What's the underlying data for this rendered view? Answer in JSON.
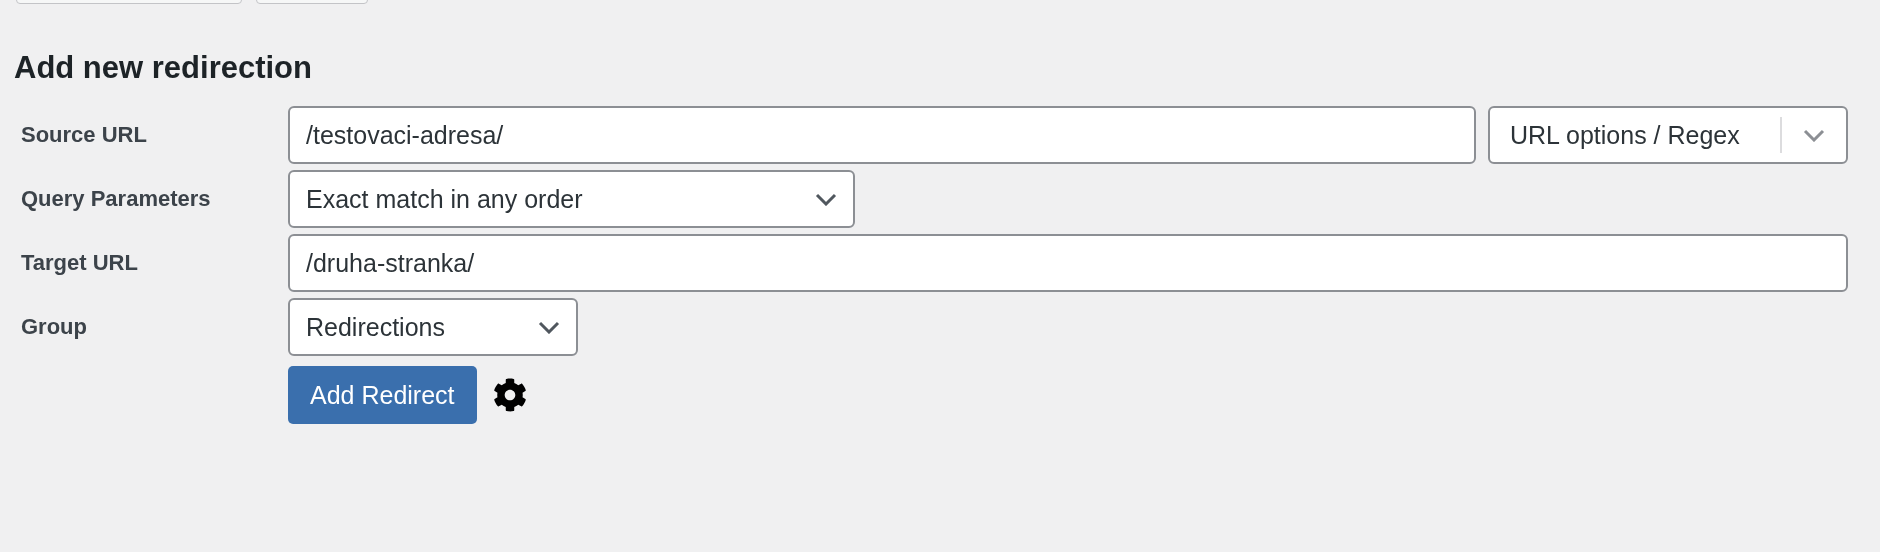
{
  "heading": "Add new redirection",
  "fields": [
    {
      "kind": "text",
      "label": "Source URL",
      "value": "/testovaci-adresa/",
      "options_button": {
        "label": "URL options / Regex"
      }
    },
    {
      "kind": "select",
      "label": "Query Parameters",
      "value": "Exact match in any order"
    },
    {
      "kind": "text",
      "label": "Target URL",
      "value": "/druha-stranka/"
    },
    {
      "kind": "select",
      "label": "Group",
      "value": "Redirections"
    }
  ],
  "submit": {
    "label": "Add Redirect"
  }
}
